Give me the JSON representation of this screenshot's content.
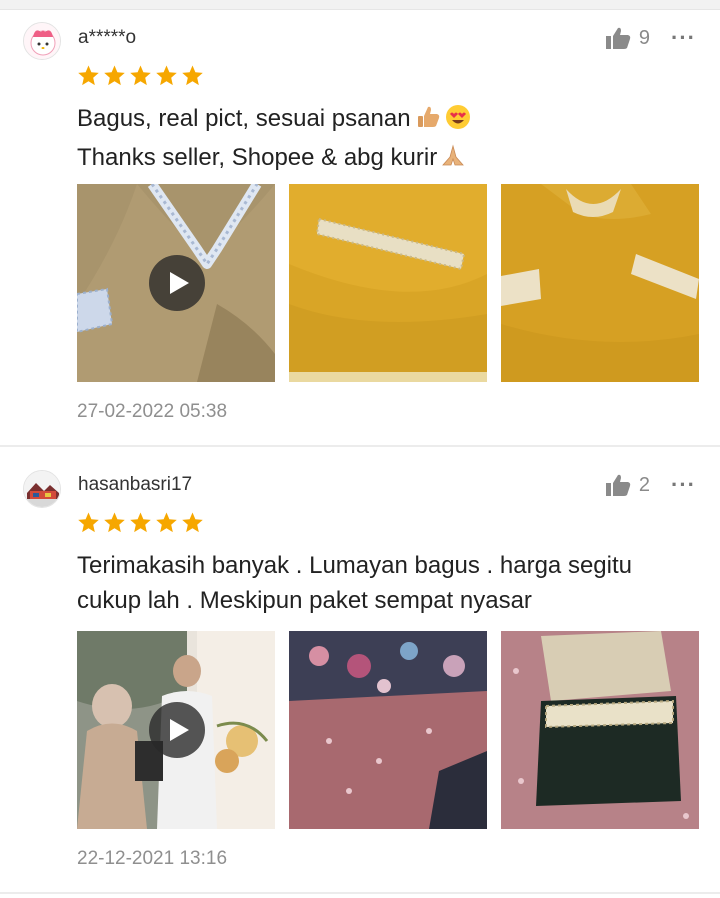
{
  "reviews": [
    {
      "username": "a*****o",
      "likes": "9",
      "more_label": "···",
      "rating": 5,
      "lines": [
        "Bagus, real pict, sesuai psanan",
        "Thanks seller, Shopee & abg kurir"
      ],
      "line_emojis": [
        [
          "thumbs-up-emoji",
          "heart-eyes-emoji"
        ],
        [
          "folded-hands-emoji"
        ]
      ],
      "media": [
        {
          "kind": "video",
          "icon": "play-icon"
        },
        {
          "kind": "photo"
        },
        {
          "kind": "photo"
        }
      ],
      "date": "27-02-2022 05:38"
    },
    {
      "username": "hasanbasri17",
      "likes": "2",
      "more_label": "···",
      "rating": 5,
      "lines": [
        "Terimakasih banyak . Lumayan bagus . harga segitu",
        "cukup lah . Meskipun paket sempat nyasar"
      ],
      "line_emojis": [
        [],
        []
      ],
      "media": [
        {
          "kind": "video",
          "icon": "play-icon"
        },
        {
          "kind": "photo"
        },
        {
          "kind": "photo"
        }
      ],
      "date": "22-12-2021 13:16"
    }
  ],
  "colors": {
    "star": "#f6a700",
    "muted": "#8f8f8f",
    "text": "#222222",
    "separator": "#ececec"
  }
}
